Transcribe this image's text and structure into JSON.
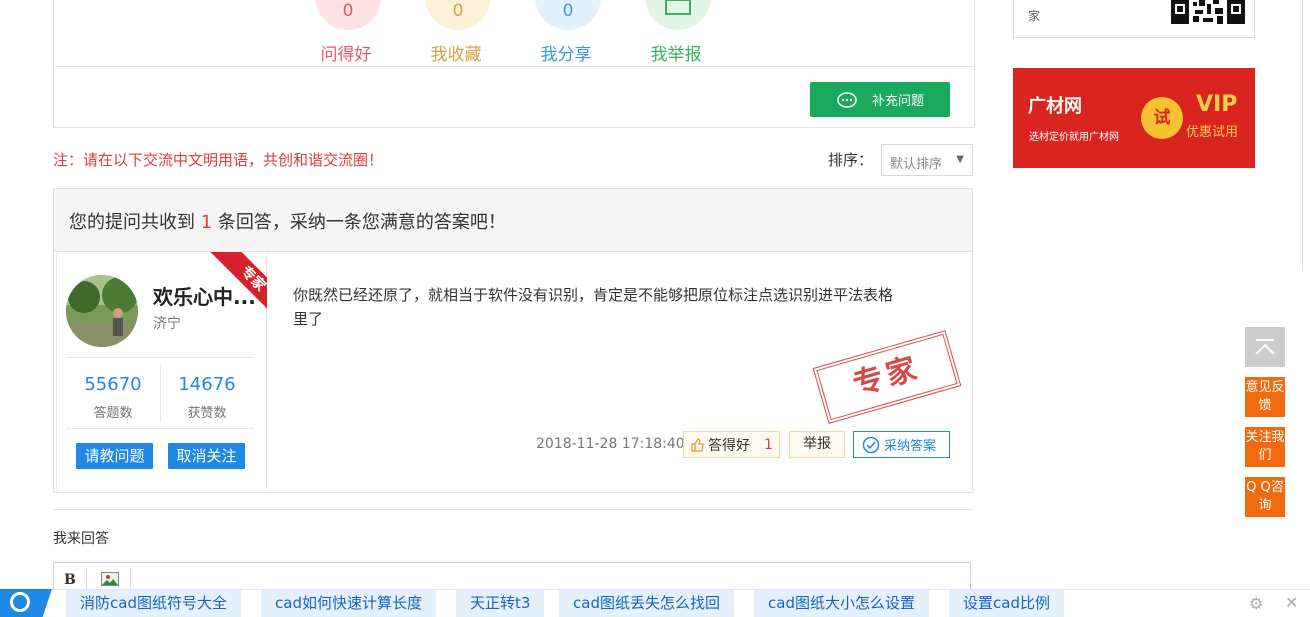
{
  "stats": [
    {
      "label": "问得好",
      "count": "0",
      "color": "#e35a6a",
      "bg": "#fde3e6"
    },
    {
      "label": "我收藏",
      "count": "0",
      "color": "#d8a044",
      "bg": "#fdf0d9"
    },
    {
      "label": "我分享",
      "count": "0",
      "color": "#3a9bd9",
      "bg": "#e0f1fc"
    },
    {
      "label": "我举报",
      "count": "",
      "color": "#3cae5f",
      "bg": "#e2f5e6"
    }
  ],
  "supplement_button": "补充问题",
  "notice": "注：请在以下交流中文明用语，共创和谐交流圈！",
  "sort": {
    "label": "排序：",
    "selected": "默认排序"
  },
  "answer_header": {
    "prefix": "您的提问共收到",
    "count": "1",
    "suffix": "条回答，采纳一条您满意的答案吧！"
  },
  "answer": {
    "ribbon": "专家",
    "user_name": "欢乐心中...",
    "user_city": "济宁",
    "answers_count": "55670",
    "answers_caption": "答题数",
    "likes_count": "14676",
    "likes_caption": "获赞数",
    "ask_button": "请教问题",
    "unfollow_button": "取消关注",
    "text": "你既然已经还原了，就相当于软件没有识别，肯定是不能够把原位标注点选识别进平法表格里了",
    "stamp": "专家",
    "time": "2018-11-28 17:18:40",
    "good_label": "答得好",
    "good_count": "1",
    "report_label": "举报",
    "accept_label": "采纳答案"
  },
  "my_answer_label": "我来回答",
  "editor": {
    "bold": "B"
  },
  "sidebar": {
    "qr_text": "家",
    "ad": {
      "logo": "广材网",
      "slogan": "选材定价就用广材网",
      "badge": "试",
      "vip": "VIP",
      "vip_sub": "优惠试用"
    },
    "feedback": "意见反馈",
    "follow": "关注我们",
    "qq": "Q Q咨询"
  },
  "bottom_tags": [
    "消防cad图纸符号大全",
    "cad如何快速计算长度",
    "天正转t3",
    "cad图纸丢失怎么找回",
    "cad图纸大小怎么设置",
    "设置cad比例"
  ]
}
